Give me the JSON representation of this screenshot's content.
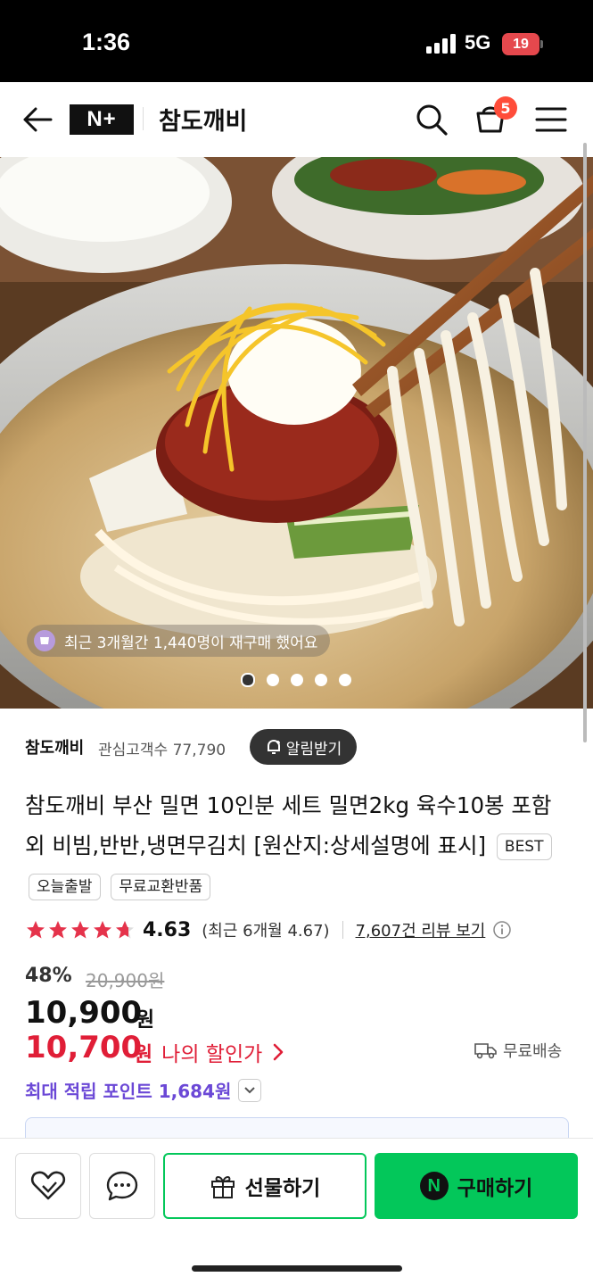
{
  "status_bar": {
    "time": "1:36",
    "network": "5G",
    "battery": "19"
  },
  "header": {
    "logo_text": "N+",
    "store_name": "참도깨비",
    "cart_count": "5"
  },
  "hero": {
    "repurchase_text": "최근 3개월간 1,440명이 재구매 했어요",
    "slide_count": 5,
    "active_slide": 1
  },
  "seller": {
    "name": "참도깨비",
    "followers": "관심고객수 77,790",
    "alert_label": "알림받기"
  },
  "product": {
    "title": "참도깨비 부산 밀면 10인분 세트 밀면2kg 육수10봉 포함 외 비빔,반반,냉면무김치 [원산지:상세설명에 표시]",
    "tags": [
      "BEST",
      "오늘출발",
      "무료교환반품"
    ]
  },
  "rating": {
    "score": "4.63",
    "recent": "(최근 6개월 4.67)",
    "review_link": "7,607건 리뷰 보기",
    "stars_value": 4.63
  },
  "pricing": {
    "discount": "48%",
    "original": "20,900원",
    "price": "10,900",
    "price_unit": "원",
    "my_price": "10,700",
    "my_price_unit": "원",
    "my_price_label": "나의 할인가",
    "shipping": "무료배송",
    "points": "최대 적립 포인트 1,684원"
  },
  "bottom_bar": {
    "gift_label": "선물하기",
    "buy_label": "구매하기",
    "buy_icon_text": "N"
  },
  "colors": {
    "accent_green": "#03c75a",
    "price_red": "#e01e37",
    "points_purple": "#6b48d6"
  }
}
